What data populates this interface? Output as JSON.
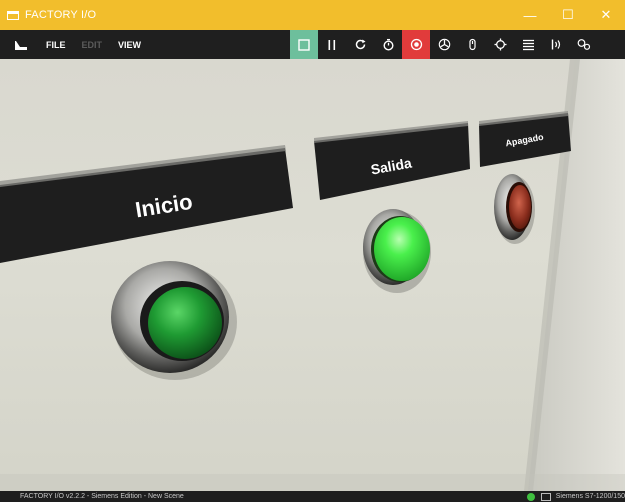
{
  "window": {
    "title": "FACTORY I/O",
    "controls": [
      "minimize-icon",
      "maximize-icon",
      "close-icon"
    ],
    "minimize_glyph": "—",
    "maximize_glyph": "☐",
    "close_glyph": "✕"
  },
  "menu": {
    "file": "FILE",
    "edit": "EDIT",
    "view": "VIEW"
  },
  "toolbar": {
    "items": [
      "select-icon",
      "pause-icon",
      "reset-icon",
      "timer-icon",
      "record-icon",
      "fan-icon",
      "hand-icon",
      "target-icon",
      "list-icon",
      "sensor-icon",
      "drivers-icon"
    ],
    "active_select_color": "#6dbf9c",
    "active_record_color": "#e13b3b"
  },
  "scene": {
    "labels": {
      "inicio": "Inicio",
      "salida": "Salida",
      "apagado": "Apagado"
    },
    "buttons": {
      "inicio_color": "green",
      "salida_color": "bright-green",
      "apagado_color": "red"
    }
  },
  "status": {
    "left": "FACTORY I/O v2.2.2 - Siemens Edition - New Scene",
    "right": "Siemens S7-1200/150"
  }
}
